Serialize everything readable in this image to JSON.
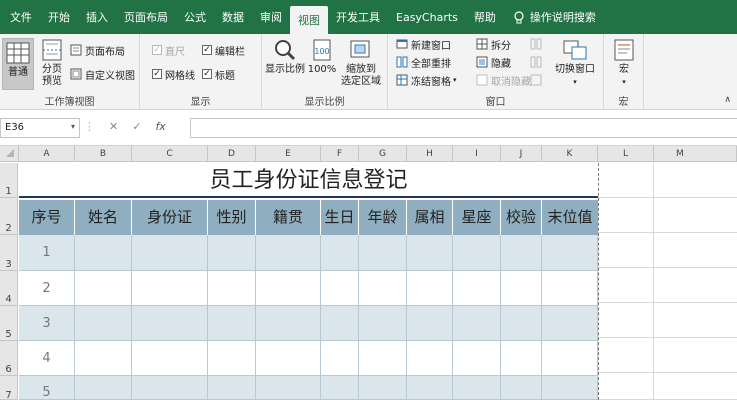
{
  "tabs": [
    "文件",
    "开始",
    "插入",
    "页面布局",
    "公式",
    "数据",
    "审阅",
    "视图",
    "开发工具",
    "EasyCharts",
    "帮助",
    "操作说明搜索"
  ],
  "active_tab": "视图",
  "ribbon": {
    "workbook_views": {
      "label": "工作簿视图",
      "normal": "普通",
      "page_break_1": "分页",
      "page_break_2": "预览",
      "page_layout": "页面布局",
      "custom_views": "自定义视图"
    },
    "show": {
      "label": "显示",
      "ruler": "直尺",
      "formula_bar": "编辑栏",
      "gridlines": "网格线",
      "headings": "标题"
    },
    "zoom": {
      "label": "显示比例",
      "zoom": "显示比例",
      "hundred": "100%",
      "to_selection_1": "缩放到",
      "to_selection_2": "选定区域"
    },
    "window": {
      "label": "窗口",
      "new_window": "新建窗口",
      "arrange_all": "全部重排",
      "freeze_panes": "冻结窗格",
      "split": "拆分",
      "hide": "隐藏",
      "unhide": "取消隐藏",
      "switch_windows": "切换窗口"
    },
    "macros": {
      "label": "宏",
      "macros": "宏"
    }
  },
  "formula_bar": {
    "name_box": "E36",
    "cancel": "✕",
    "enter": "✓",
    "fx": "fx",
    "formula": ""
  },
  "sheet": {
    "columns": [
      "A",
      "B",
      "C",
      "D",
      "E",
      "F",
      "G",
      "H",
      "I",
      "J",
      "K",
      "L",
      "M"
    ],
    "rows": [
      "1",
      "2",
      "3",
      "4",
      "5",
      "6",
      "7"
    ],
    "title": "员工身份证信息登记",
    "headers": [
      "序号",
      "姓名",
      "身份证",
      "性别",
      "籍贯",
      "生日",
      "年龄",
      "属相",
      "星座",
      "校验",
      "末位值"
    ],
    "data": [
      "1",
      "2",
      "3",
      "4",
      "5"
    ]
  }
}
